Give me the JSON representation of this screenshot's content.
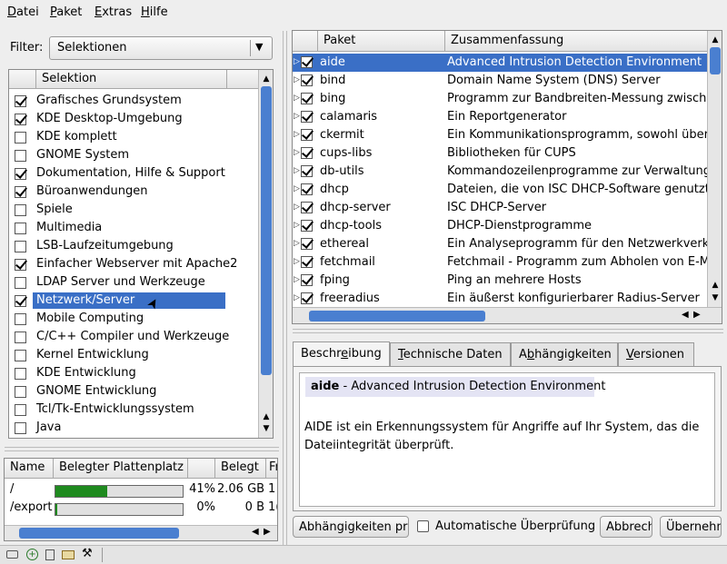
{
  "menu": {
    "items": [
      {
        "pre": "",
        "u": "D",
        "post": "atei"
      },
      {
        "pre": "",
        "u": "P",
        "post": "aket"
      },
      {
        "pre": "",
        "u": "E",
        "post": "xtras"
      },
      {
        "pre": "",
        "u": "H",
        "post": "ilfe"
      }
    ]
  },
  "filter": {
    "label": "Filter:",
    "value": "Selektionen"
  },
  "selections": {
    "header": "Selektion",
    "items": [
      {
        "label": "Grafisches Grundsystem",
        "checked": true
      },
      {
        "label": "KDE Desktop-Umgebung",
        "checked": true
      },
      {
        "label": "KDE komplett",
        "checked": false
      },
      {
        "label": "GNOME System",
        "checked": false
      },
      {
        "label": "Dokumentation, Hilfe & Support",
        "checked": true
      },
      {
        "label": "Büroanwendungen",
        "checked": true
      },
      {
        "label": "Spiele",
        "checked": false
      },
      {
        "label": "Multimedia",
        "checked": false
      },
      {
        "label": "LSB-Laufzeitumgebung",
        "checked": false
      },
      {
        "label": "Einfacher Webserver mit Apache2",
        "checked": true
      },
      {
        "label": "LDAP Server und Werkzeuge",
        "checked": false
      },
      {
        "label": "Netzwerk/Server",
        "checked": true,
        "selected": true
      },
      {
        "label": "Mobile Computing",
        "checked": false
      },
      {
        "label": "C/C++ Compiler und Werkzeuge",
        "checked": false
      },
      {
        "label": "Kernel Entwicklung",
        "checked": false
      },
      {
        "label": "KDE Entwicklung",
        "checked": false
      },
      {
        "label": "GNOME Entwicklung",
        "checked": false
      },
      {
        "label": "Tcl/Tk-Entwicklungssystem",
        "checked": false
      },
      {
        "label": "Java",
        "checked": false
      }
    ]
  },
  "disk": {
    "headers": [
      "Name",
      "Belegter Plattenplatz",
      "Belegt",
      "Fr"
    ],
    "rows": [
      {
        "name": "/",
        "percent_text": "41%",
        "fill": 0.41,
        "used": "2.06 GB",
        "free": "1"
      },
      {
        "name": "/export",
        "percent_text": "0%",
        "fill": 0.0,
        "used": "0 B",
        "free": "1("
      }
    ]
  },
  "packages": {
    "headers": [
      "Paket",
      "Zusammenfassung"
    ],
    "rows": [
      {
        "name": "aide",
        "summary": "Advanced Intrusion Detection Environment",
        "selected": true
      },
      {
        "name": "bind",
        "summary": "Domain Name System (DNS) Server"
      },
      {
        "name": "bing",
        "summary": "Programm zur Bandbreiten-Messung zwischen"
      },
      {
        "name": "calamaris",
        "summary": "Ein Reportgenerator"
      },
      {
        "name": "ckermit",
        "summary": "Ein Kommunikationsprogramm, sowohl über ein"
      },
      {
        "name": "cups-libs",
        "summary": "Bibliotheken für CUPS"
      },
      {
        "name": "db-utils",
        "summary": "Kommandozeilenprogramme zur Verwaltung vo"
      },
      {
        "name": "dhcp",
        "summary": "Dateien, die von ISC DHCP-Software genutzt w"
      },
      {
        "name": "dhcp-server",
        "summary": "ISC DHCP-Server"
      },
      {
        "name": "dhcp-tools",
        "summary": "DHCP-Dienstprogramme"
      },
      {
        "name": "ethereal",
        "summary": "Ein Analyseprogramm für den Netzwerkverkehr"
      },
      {
        "name": "fetchmail",
        "summary": "Fetchmail - Programm zum Abholen von E-Mail v"
      },
      {
        "name": "fping",
        "summary": "Ping an mehrere Hosts"
      },
      {
        "name": "freeradius",
        "summary": "Ein äußerst konfigurierbarer Radius-Server"
      }
    ]
  },
  "tabs": [
    {
      "pre": "Beschr",
      "u": "e",
      "post": "ibung",
      "active": true
    },
    {
      "pre": "",
      "u": "T",
      "post": "echnische Daten"
    },
    {
      "pre": "A",
      "u": "b",
      "post": "hängigkeiten"
    },
    {
      "pre": "",
      "u": "V",
      "post": "ersionen"
    }
  ],
  "description": {
    "pkg_name": "aide",
    "pkg_title": " - Advanced Intrusion Detection Environment",
    "body": "AIDE ist ein Erkennungssystem für Angriffe auf Ihr System, das die Dateiintegrität überprüft."
  },
  "actions": {
    "check_deps": "Abhängigkeiten prüfen",
    "auto_check": "Automatische Überprüfung",
    "cancel": "Abbrechen",
    "accept": "Übernehmen"
  },
  "colors": {
    "selection": "#3a6fc6",
    "progress": "#1f8a1f"
  }
}
